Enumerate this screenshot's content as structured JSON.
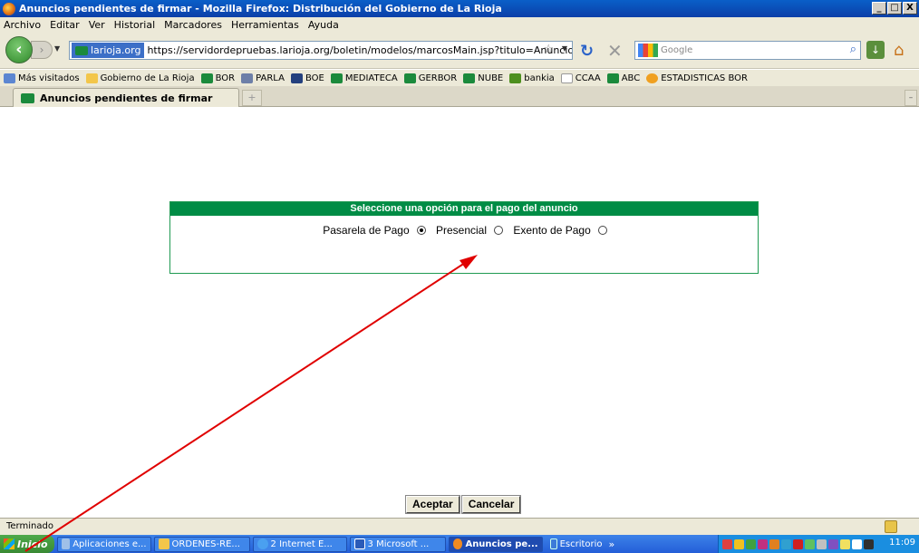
{
  "window": {
    "title": "Anuncios pendientes de firmar - Mozilla Firefox: Distribución del Gobierno de La Rioja",
    "buttons": [
      "_",
      "□",
      "X"
    ]
  },
  "menu": [
    "Archivo",
    "Editar",
    "Ver",
    "Historial",
    "Marcadores",
    "Herramientas",
    "Ayuda"
  ],
  "nav": {
    "site_identity": "larioja.org",
    "url": "https://servidordepruebas.larioja.org/boletin/modelos/marcosMain.jsp?titulo=Anuncios pendier",
    "search_placeholder": "Google"
  },
  "bookmarks": [
    {
      "label": "Más visitados",
      "icon": "most-visited-icon"
    },
    {
      "label": "Gobierno de La Rioja",
      "icon": "folder-icon"
    },
    {
      "label": "BOR",
      "icon": "larioja-icon"
    },
    {
      "label": "PARLA",
      "icon": "parla-icon"
    },
    {
      "label": "BOE",
      "icon": "boe-icon"
    },
    {
      "label": "MEDIATECA",
      "icon": "larioja-icon"
    },
    {
      "label": "GERBOR",
      "icon": "larioja-icon"
    },
    {
      "label": "NUBE",
      "icon": "larioja-icon"
    },
    {
      "label": "bankia",
      "icon": "bankia-icon"
    },
    {
      "label": "CCAA",
      "icon": "page-icon"
    },
    {
      "label": "ABC",
      "icon": "larioja-icon"
    },
    {
      "label": "ESTADISTICAS BOR",
      "icon": "firefox-icon"
    }
  ],
  "tab": {
    "label": "Anuncios pendientes de firmar",
    "new_tab": "+",
    "list": "–"
  },
  "form": {
    "heading": "Seleccione una opción para el pago del anuncio",
    "options": [
      {
        "label": "Pasarela de Pago",
        "checked": true
      },
      {
        "label": "Presencial",
        "checked": false
      },
      {
        "label": "Exento de Pago",
        "checked": false
      }
    ],
    "accept": "Aceptar",
    "cancel": "Cancelar"
  },
  "status": "Terminado",
  "taskbar": {
    "start": "Inicio",
    "tasks": [
      {
        "label": "Aplicaciones e...",
        "active": false
      },
      {
        "label": "ORDENES-RE...",
        "active": false
      },
      {
        "label": "2 Internet E...",
        "active": false
      },
      {
        "label": "3 Microsoft ...",
        "active": false
      },
      {
        "label": "Anuncios pe...",
        "active": true
      },
      {
        "label": "Escritorio",
        "active": false
      }
    ],
    "overflow": "»",
    "clock": "11:09"
  },
  "colors": {
    "header_green": "#008c45",
    "annotation_red": "#e00000"
  }
}
